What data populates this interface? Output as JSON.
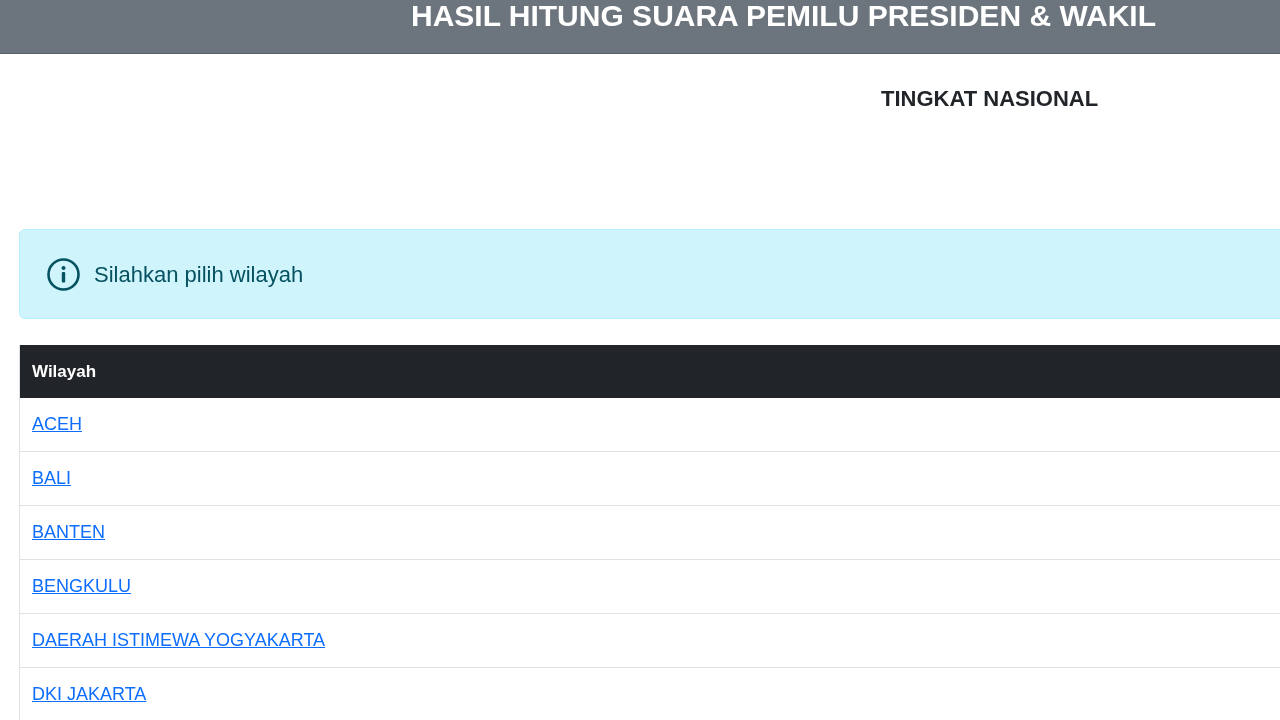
{
  "header": {
    "title": "HASIL HITUNG SUARA PEMILU PRESIDEN & WAKIL"
  },
  "subtitle": "TINGKAT NASIONAL",
  "alert": {
    "message": "Silahkan pilih wilayah"
  },
  "table": {
    "columns": [
      "Wilayah"
    ],
    "rows": [
      [
        "ACEH"
      ],
      [
        "BALI"
      ],
      [
        "BANTEN"
      ],
      [
        "BENGKULU"
      ],
      [
        "DAERAH ISTIMEWA YOGYAKARTA"
      ],
      [
        "DKI JAKARTA"
      ]
    ]
  }
}
